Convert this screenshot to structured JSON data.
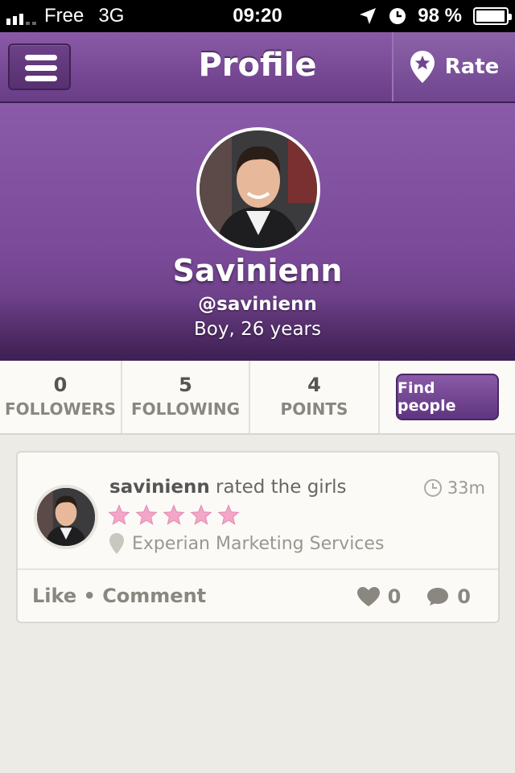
{
  "status_bar": {
    "carrier": "Free",
    "network": "3G",
    "time": "09:20",
    "battery": "98 %"
  },
  "nav": {
    "title": "Profile",
    "rate_label": "Rate"
  },
  "profile": {
    "name": "Savinienn",
    "handle": "@savinienn",
    "meta": "Boy, 26 years"
  },
  "stats": [
    {
      "value": "0",
      "label": "FOLLOWERS"
    },
    {
      "value": "5",
      "label": "FOLLOWING"
    },
    {
      "value": "4",
      "label": "POINTS"
    }
  ],
  "find_people_label": "Find people",
  "feed": {
    "user": "savinienn",
    "action": "rated the girls",
    "time": "33m",
    "rating": 5,
    "location": "Experian Marketing Services",
    "like_label": "Like",
    "separator": "•",
    "comment_label": "Comment",
    "likes": "0",
    "comments": "0"
  },
  "colors": {
    "brand_purple": "#7a4a98",
    "star_pink": "#f3a6c8",
    "background": "#ecebe5"
  }
}
